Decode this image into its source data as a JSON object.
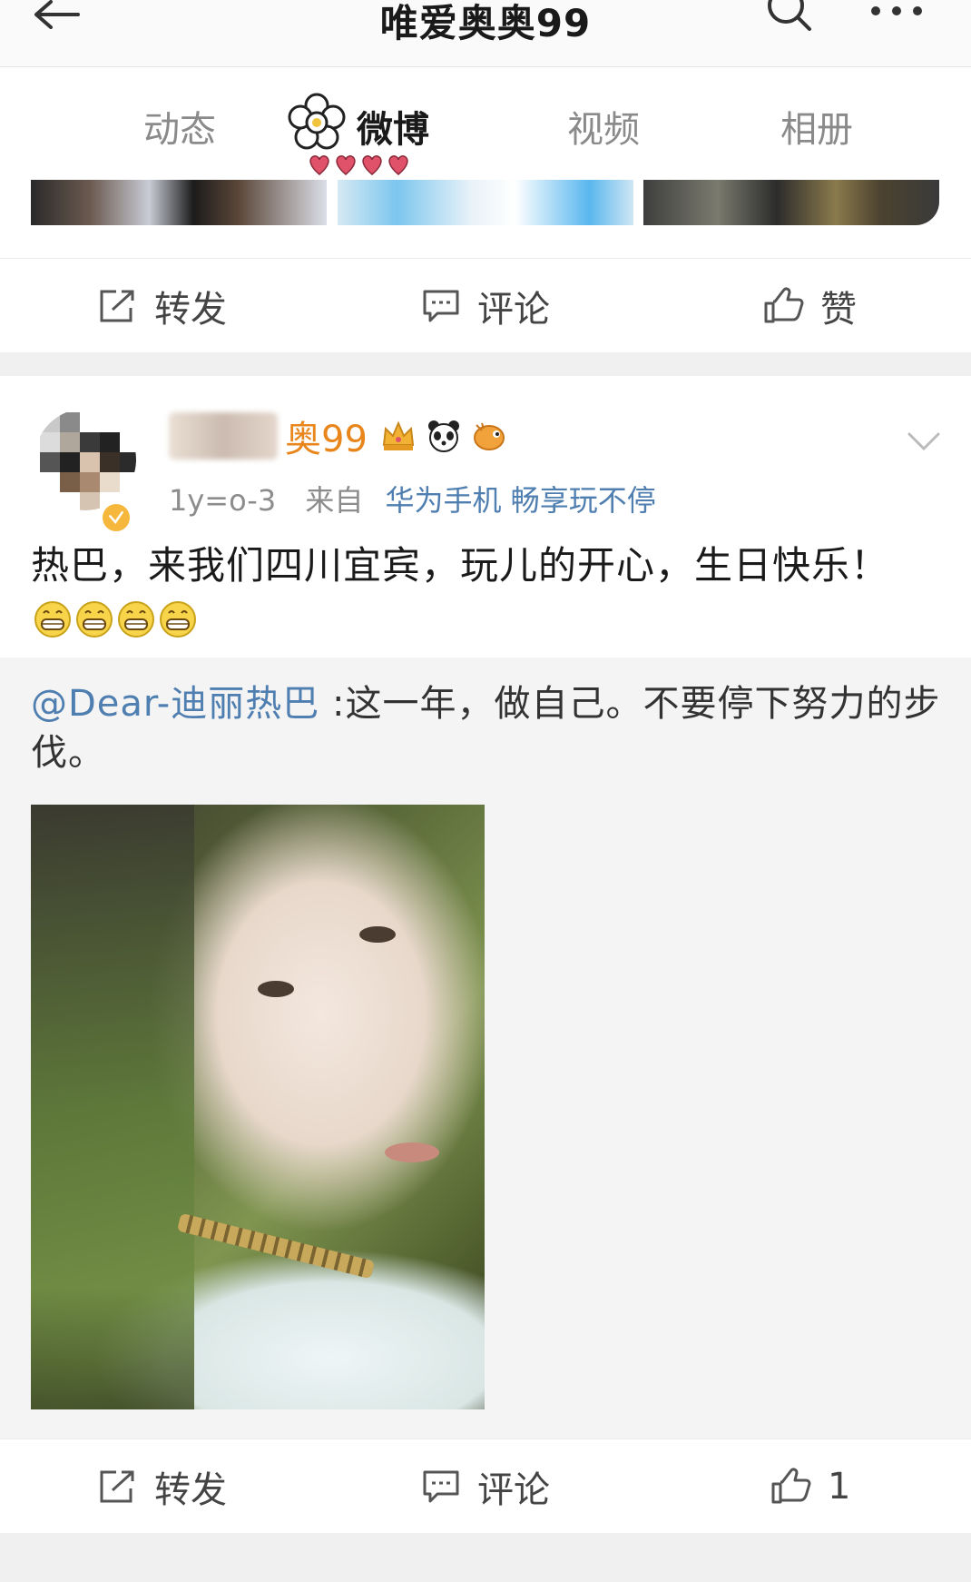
{
  "header": {
    "title": "唯爱奥奥99",
    "icons": [
      "back-arrow-icon",
      "search-icon",
      "more-icon"
    ]
  },
  "tabs": [
    {
      "label": "动态",
      "active": false
    },
    {
      "label": "微博",
      "active": true
    },
    {
      "label": "视频",
      "active": false
    },
    {
      "label": "相册",
      "active": false
    }
  ],
  "actions_top": {
    "repost": "转发",
    "comment": "评论",
    "like": "赞"
  },
  "post": {
    "username_visible": "奥99",
    "date": "1y=o-3",
    "source_prefix": "来自",
    "source_device": "华为手机 畅享玩不停",
    "text": "热巴，来我们四川宜宾，玩儿的开心，生日快乐！",
    "emoji_count": 4
  },
  "retweet": {
    "mention": "@Dear-迪丽热巴",
    "text": " :这一年，做自己。不要停下努力的步伐。"
  },
  "actions_bottom": {
    "repost": "转发",
    "comment": "评论",
    "like_count": "1"
  },
  "colors": {
    "accent_orange": "#e8861c",
    "link_blue": "#4f7eb0",
    "heart_red": "#e0526a"
  }
}
